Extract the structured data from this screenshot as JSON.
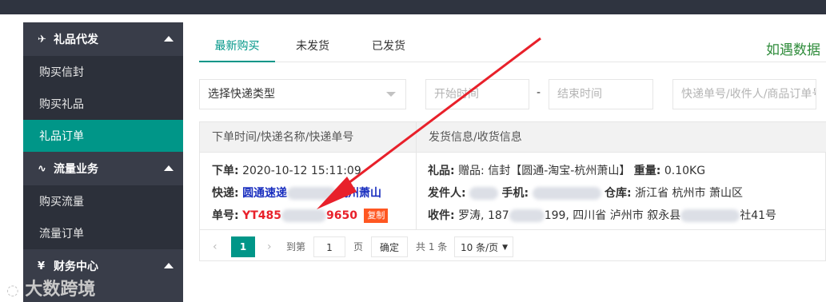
{
  "sidebar": {
    "sections": [
      {
        "label": "礼品代发",
        "icon": "send-icon"
      },
      {
        "label": "流量业务",
        "icon": "pulse-icon"
      },
      {
        "label": "财务中心",
        "icon": "yen-icon"
      }
    ],
    "items": [
      {
        "label": "购买信封"
      },
      {
        "label": "购买礼品"
      },
      {
        "label": "礼品订单"
      },
      {
        "label": "购买流量"
      },
      {
        "label": "流量订单"
      }
    ]
  },
  "tabs": [
    {
      "label": "最新购买"
    },
    {
      "label": "未发货"
    },
    {
      "label": "已发货"
    }
  ],
  "notice": "如遇数据",
  "filters": {
    "express_type": "选择快递类型",
    "start_placeholder": "开始时间",
    "separator": "-",
    "end_placeholder": "结束时间",
    "search_placeholder": "快递单号/收件人/商品订单号"
  },
  "table": {
    "headers": [
      "下单时间/快递名称/快递单号",
      "发货信息/收货信息"
    ],
    "row": {
      "order_label": "下单:",
      "order_time": "2020-10-12 15:11:09",
      "express_label": "快递:",
      "express_name_a": "圆通速递",
      "express_name_b": "杭州萧山",
      "tracking_label": "单号:",
      "tracking_a": "YT485",
      "tracking_b": "9650",
      "copy_label": "复制",
      "gift_label": "礼品:",
      "gift_value": "赠品: 信封【圆通-淘宝-杭州萧山】",
      "weight_label": "重量:",
      "weight_value": "0.10KG",
      "sender_label": "发件人:",
      "phone_label": "手机:",
      "warehouse_label": "仓库:",
      "warehouse_value": "浙江省 杭州市 萧山区",
      "receiver_label": "收件:",
      "receiver_a": "罗涛, 187",
      "receiver_b": "199, 四川省 泸州市 叙永县",
      "receiver_c": "社41号"
    }
  },
  "pager": {
    "prev": "‹",
    "page": "1",
    "next": "›",
    "goto_label": "到第",
    "goto_value": "1",
    "page_unit": "页",
    "confirm": "确定",
    "total": "共 1 条",
    "page_size": "10 条/页"
  },
  "watermark": "大数跨境",
  "colors": {
    "accent": "#009688",
    "sidebar": "#393d49",
    "link": "#1a2fbf",
    "tracking": "#e8202a",
    "copy_badge": "#ff5722",
    "arrow": "#e8202a"
  }
}
